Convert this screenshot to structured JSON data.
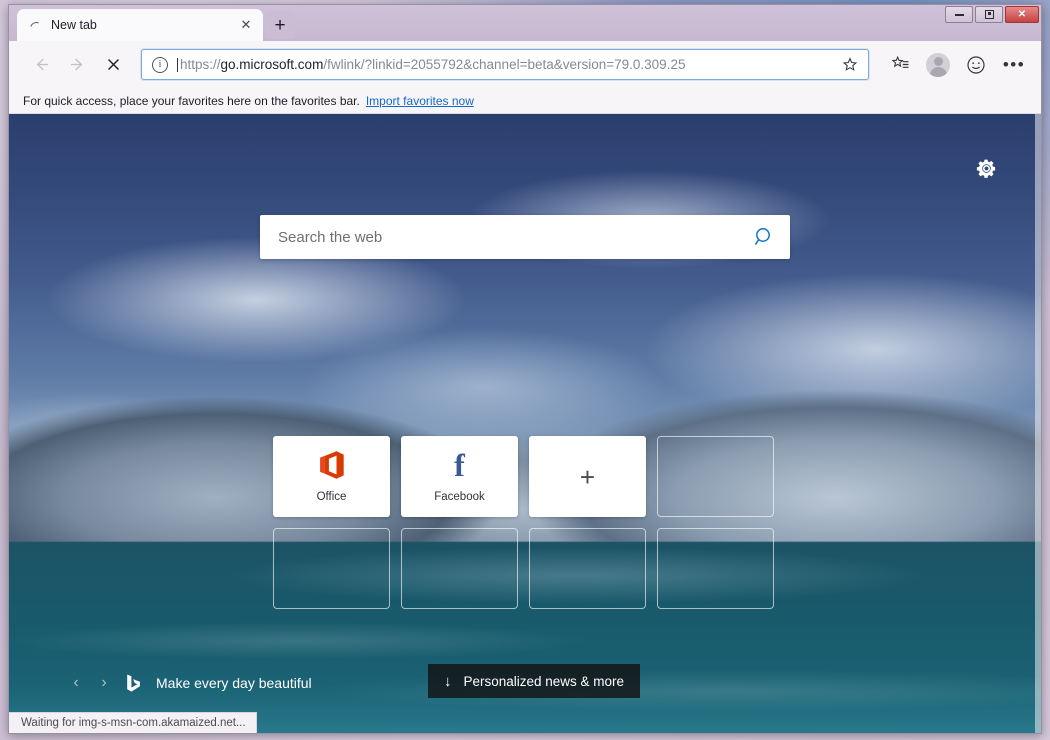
{
  "window": {
    "controls": {
      "minimize": "Minimize",
      "maximize": "Restore",
      "close": "✕"
    }
  },
  "tabstrip": {
    "tabs": [
      {
        "title": "New tab",
        "loading": true,
        "close_label": "✕"
      }
    ],
    "new_tab_label": "+"
  },
  "toolbar": {
    "back_label": "Back",
    "forward_label": "Forward",
    "stop_label": "Stop",
    "url_prefix": "https://",
    "url_host": "go.microsoft.com",
    "url_path": "/fwlink/?linkid=2055792&channel=beta&version=79.0.309.25",
    "url_full": "https://go.microsoft.com/fwlink/?linkid=2055792&channel=beta&version=79.0.309.25",
    "site_info_glyph": "i",
    "favorite_label": "Add to favorites",
    "collections_label": "Favorites",
    "profile_label": "Profile",
    "feedback_label": "Send feedback",
    "settings_label": "•••"
  },
  "favorites_bar": {
    "message": "For quick access, place your favorites here on the favorites bar.",
    "link": "Import favorites now"
  },
  "newtab": {
    "settings_label": "Page settings",
    "search": {
      "placeholder": "Search the web",
      "button_label": "Search"
    },
    "tiles": [
      {
        "label": "Office",
        "type": "site",
        "icon": "office-icon",
        "color": "#D83B01"
      },
      {
        "label": "Facebook",
        "type": "site",
        "icon": "facebook-icon",
        "color": "#3b5998",
        "glyph": "f"
      },
      {
        "label": "",
        "type": "add",
        "icon": "plus-icon",
        "glyph": "+"
      },
      {
        "label": "",
        "type": "empty"
      },
      {
        "label": "",
        "type": "empty"
      },
      {
        "label": "",
        "type": "empty"
      },
      {
        "label": "",
        "type": "empty"
      },
      {
        "label": "",
        "type": "empty"
      }
    ],
    "bing": {
      "prev_label": "‹",
      "next_label": "›",
      "caption": "Make every day beautiful"
    },
    "news_button": {
      "arrow": "↓",
      "label": "Personalized news & more"
    }
  },
  "statusbar": {
    "text": "Waiting for img-s-msn-com.akamaized.net..."
  },
  "colors": {
    "accent_blue": "#1274c6",
    "link_blue": "#1668c9",
    "office_orange": "#D83B01",
    "facebook_blue": "#3b5998",
    "omnibox_border": "#7ea9e0"
  }
}
